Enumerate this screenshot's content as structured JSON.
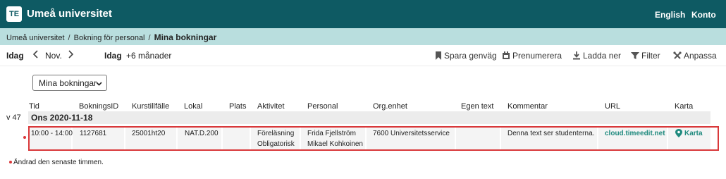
{
  "header": {
    "logo": "TE",
    "title": "Umeå universitet",
    "links": [
      "English",
      "Konto"
    ]
  },
  "breadcrumb": {
    "items": [
      "Umeå universitet",
      "Bokning för personal"
    ],
    "separator": "/",
    "current": "Mina bokningar"
  },
  "nav": {
    "today": "Idag",
    "prev_icon": "chevron-left-icon",
    "month": "Nov.",
    "next_icon": "chevron-right-icon",
    "today2": "Idag",
    "range": "+6 månader"
  },
  "tools": [
    {
      "label": "Spara genväg",
      "icon": "bookmark-icon"
    },
    {
      "label": "Prenumerera",
      "icon": "calendar-icon"
    },
    {
      "label": "Ladda ner",
      "icon": "download-icon"
    },
    {
      "label": "Filter",
      "icon": "filter-icon"
    },
    {
      "label": "Anpassa",
      "icon": "tools-icon"
    }
  ],
  "view_select": {
    "value": "Mina bokningar",
    "icon": "chevron-down-icon"
  },
  "table": {
    "columns": [
      "Tid",
      "BokningsID",
      "Kurstillfälle",
      "Lokal",
      "Plats",
      "Aktivitet",
      "Personal",
      "Org.enhet",
      "Egen text",
      "Kommentar",
      "URL",
      "Karta"
    ],
    "week": "v 47",
    "day": "Ons 2020-11-18",
    "row": {
      "tid": "10:00 - 14:00",
      "bokningsid": "1127681",
      "kurstillfalle": "25001ht20",
      "lokal": "NAT.D.200",
      "plats": "",
      "aktivitet": [
        "Föreläsning",
        "Obligatorisk"
      ],
      "personal": [
        "Frida Fjellström",
        "Mikael Kohkoinen"
      ],
      "orgenhet": "7600 Universitetsservice",
      "egen_text": "",
      "kommentar": "Denna text ser studenterna.",
      "url": "cloud.timeedit.net",
      "karta": "Karta",
      "karta_icon": "map-pin-icon"
    }
  },
  "note": "Ändrad den senaste timmen.",
  "colors": {
    "header": "#0e5a63",
    "breadcrumb": "#b9dede",
    "link": "#1f8a7e",
    "highlight": "#d9383a"
  }
}
